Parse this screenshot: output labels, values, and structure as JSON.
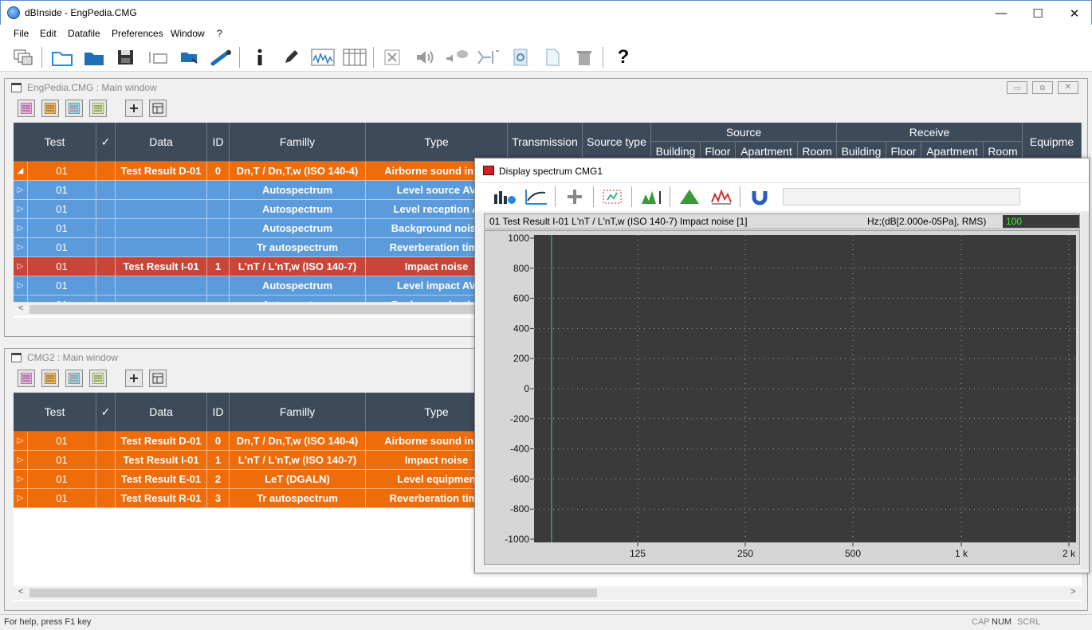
{
  "app": {
    "title": "dBInside - EngPedia.CMG"
  },
  "window_controls": {
    "minimize": "—",
    "maximize": "☐",
    "close": "✕"
  },
  "menu": [
    "File",
    "Edit",
    "Datafile",
    "Preferences",
    "Window",
    "?"
  ],
  "toolbar_icons": [
    "windows-icon",
    "new-folder-icon",
    "open-folder-icon",
    "save-icon",
    "export-icon",
    "import-icon",
    "link-icon",
    "info-icon",
    "edit-icon",
    "spectrum-icon",
    "table-icon",
    "excel-icon",
    "sound-icon",
    "speech-icon",
    "filter-icon",
    "settings-icon",
    "document-icon",
    "delete-icon",
    "help-icon"
  ],
  "main_window": {
    "title": "EngPedia.CMG : Main window",
    "headers": {
      "test": "Test",
      "check": "✓",
      "data": "Data",
      "id": "ID",
      "family": "Familly",
      "type": "Type",
      "transmission": "Transmission",
      "source_type": "Source type",
      "source": "Source",
      "receive": "Receive",
      "equipment": "Equipme",
      "building": "Building",
      "floor": "Floor",
      "apartment": "Apartment",
      "room": "Room"
    },
    "rows": [
      {
        "expander": "◢",
        "test": "01",
        "data": "Test Result D-01",
        "id": "0",
        "family": "Dn,T / Dn,T,w (ISO 140-4)",
        "type": "Airborne sound insul",
        "color": "orange"
      },
      {
        "expander": "▷",
        "test": "01",
        "data": "",
        "id": "",
        "family": "Autospectrum",
        "type": "Level source AV",
        "color": "blue"
      },
      {
        "expander": "▷",
        "test": "01",
        "data": "",
        "id": "",
        "family": "Autospectrum",
        "type": "Level reception A",
        "color": "blue"
      },
      {
        "expander": "▷",
        "test": "01",
        "data": "",
        "id": "",
        "family": "Autospectrum",
        "type": "Background noise",
        "color": "blue"
      },
      {
        "expander": "▷",
        "test": "01",
        "data": "",
        "id": "",
        "family": "Tr autospectrum",
        "type": "Reverberation time",
        "color": "blue"
      },
      {
        "expander": "▷",
        "test": "01",
        "data": "Test Result I-01",
        "id": "1",
        "family": "L'nT / L'nT,w (ISO 140-7)",
        "type": "Impact noise",
        "color": "red"
      },
      {
        "expander": "▷",
        "test": "01",
        "data": "",
        "id": "",
        "family": "Autospectrum",
        "type": "Level impact AV",
        "color": "blue"
      },
      {
        "expander": "▷",
        "test": "01",
        "data": "",
        "id": "",
        "family": "Autospectrum",
        "type": "Background noise",
        "color": "blue"
      }
    ]
  },
  "cmg2_window": {
    "title": "CMG2 : Main window",
    "rows": [
      {
        "expander": "▷",
        "test": "01",
        "data": "Test Result D-01",
        "id": "0",
        "family": "Dn,T / Dn,T,w (ISO 140-4)",
        "type": "Airborne sound insul",
        "color": "orange"
      },
      {
        "expander": "▷",
        "test": "01",
        "data": "Test Result I-01",
        "id": "1",
        "family": "L'nT / L'nT,w (ISO 140-7)",
        "type": "Impact noise",
        "color": "orange"
      },
      {
        "expander": "▷",
        "test": "01",
        "data": "Test Result E-01",
        "id": "2",
        "family": "LeT (DGALN)",
        "type": "Level equipmen",
        "color": "orange"
      },
      {
        "expander": "▷",
        "test": "01",
        "data": "Test Result R-01",
        "id": "3",
        "family": "Tr autospectrum",
        "type": "Reverberation time",
        "color": "orange"
      }
    ]
  },
  "spectrum": {
    "title": "Display spectrum CMG1",
    "trace_label": "01 Test Result I-01 L'nT / L'nT,w (ISO 140-7) Impact noise [1]",
    "units": "Hz;(dB[2.000e-05Pa], RMS)",
    "value_box": "100",
    "y_ticks": [
      "1000",
      "800",
      "600",
      "400",
      "200",
      "0",
      "-200",
      "-400",
      "-600",
      "-800",
      "-1000"
    ],
    "x_ticks": [
      "125",
      "250",
      "500",
      "1 k",
      "2 k"
    ]
  },
  "status": {
    "help": "For help, press F1 key",
    "cap": "CAP",
    "num": "NUM",
    "scrl": "SCRL"
  },
  "colors": {
    "orange": "#ef6c0b",
    "blue": "#5b9bdb",
    "red": "#c9453a",
    "header": "#3d4a5a",
    "plot_bg": "#3a3a3a"
  }
}
